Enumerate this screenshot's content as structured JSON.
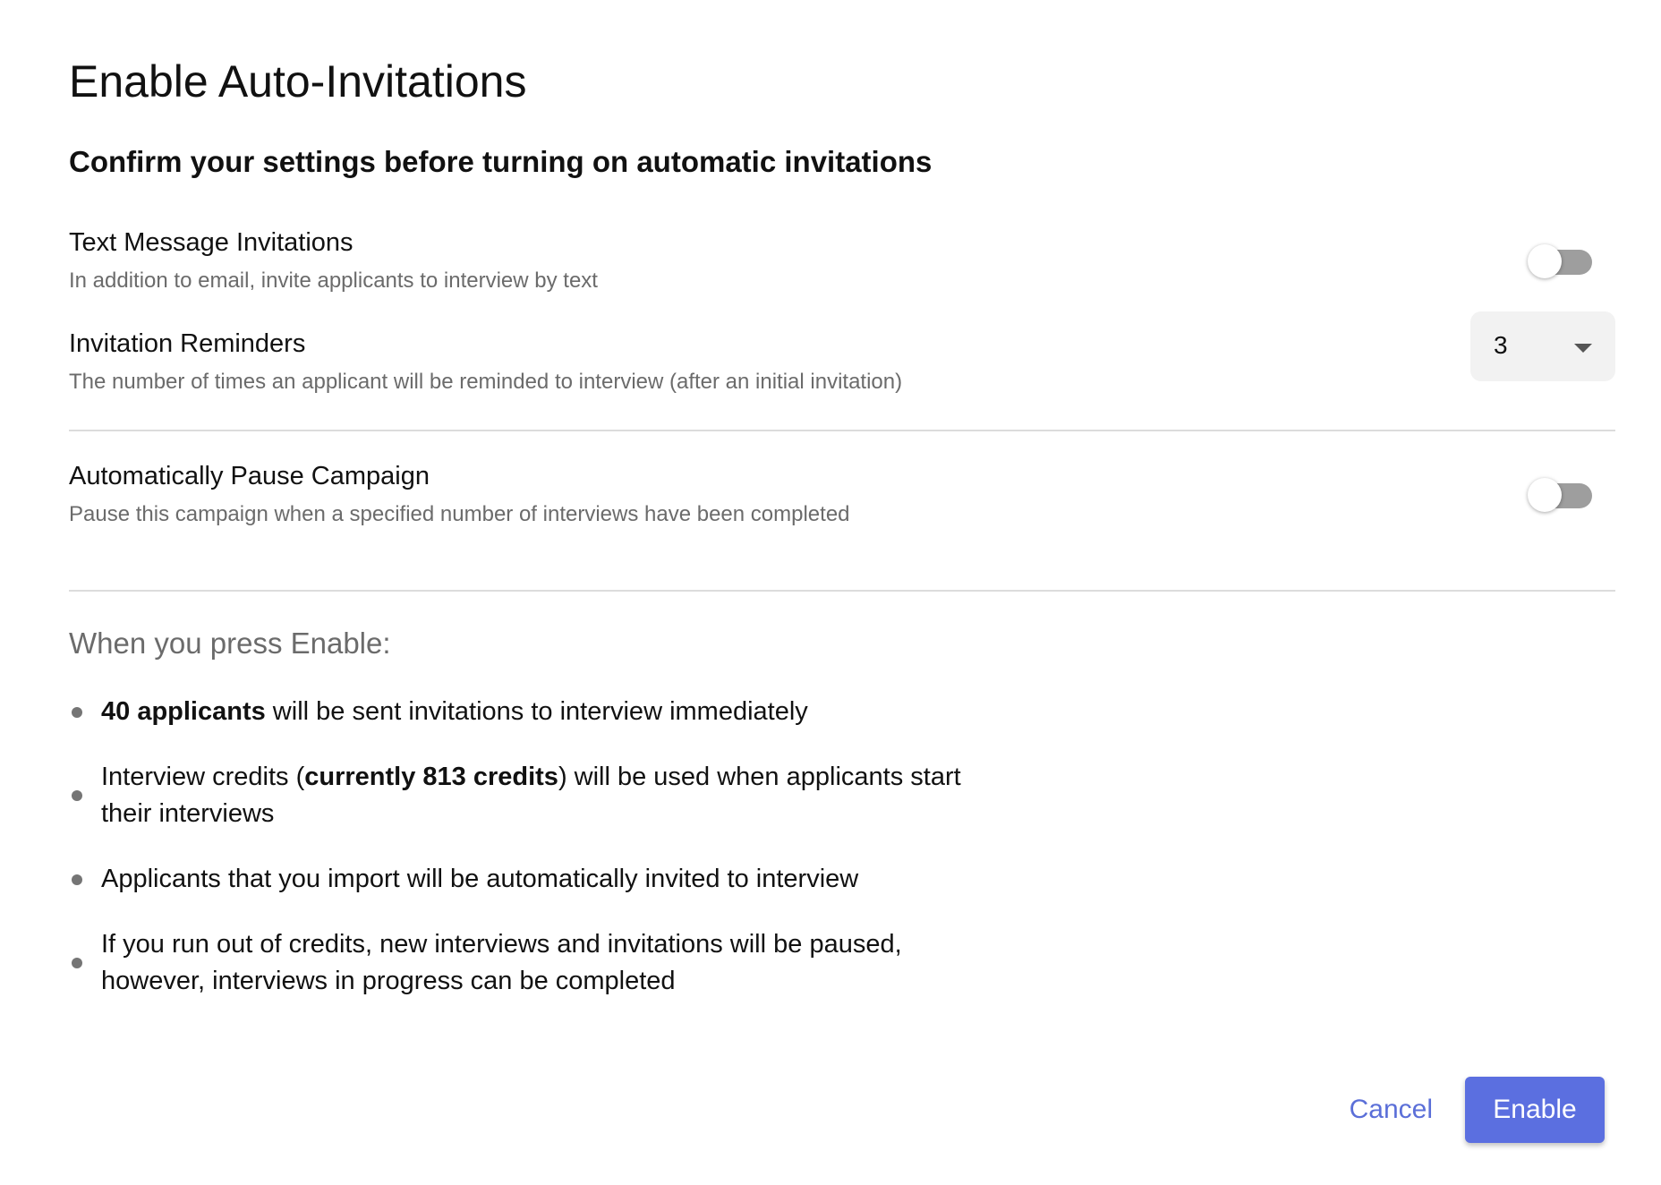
{
  "dialog": {
    "title": "Enable Auto-Invitations",
    "subtitle": "Confirm your settings before turning on automatic invitations"
  },
  "settings": {
    "text_invitations": {
      "label": "Text Message Invitations",
      "description": "In addition to email, invite applicants to interview by text",
      "enabled": false
    },
    "reminders": {
      "label": "Invitation Reminders",
      "description": "The number of times an applicant will be reminded to interview (after an initial invitation)",
      "value": "3"
    },
    "auto_pause": {
      "label": "Automatically Pause Campaign",
      "description": "Pause this campaign when a specified number of interviews have been completed",
      "enabled": false
    }
  },
  "summary": {
    "heading": "When you press Enable:",
    "bullets": [
      {
        "bold": "40 applicants",
        "rest": " will be sent invitations to interview immediately"
      },
      {
        "pre": "Interview credits (",
        "bold": "currently 813 credits",
        "rest": ") will be used when applicants start their interviews"
      },
      {
        "text": "Applicants that you import will be automatically invited to interview"
      },
      {
        "text": "If you run out of credits, new interviews and invitations will be paused, however, interviews in progress can be completed"
      }
    ]
  },
  "footer": {
    "cancel_label": "Cancel",
    "enable_label": "Enable"
  },
  "colors": {
    "accent": "#5b6fe0",
    "toggle_off_track": "#9e9e9e",
    "muted_text": "#6b6b6b"
  }
}
